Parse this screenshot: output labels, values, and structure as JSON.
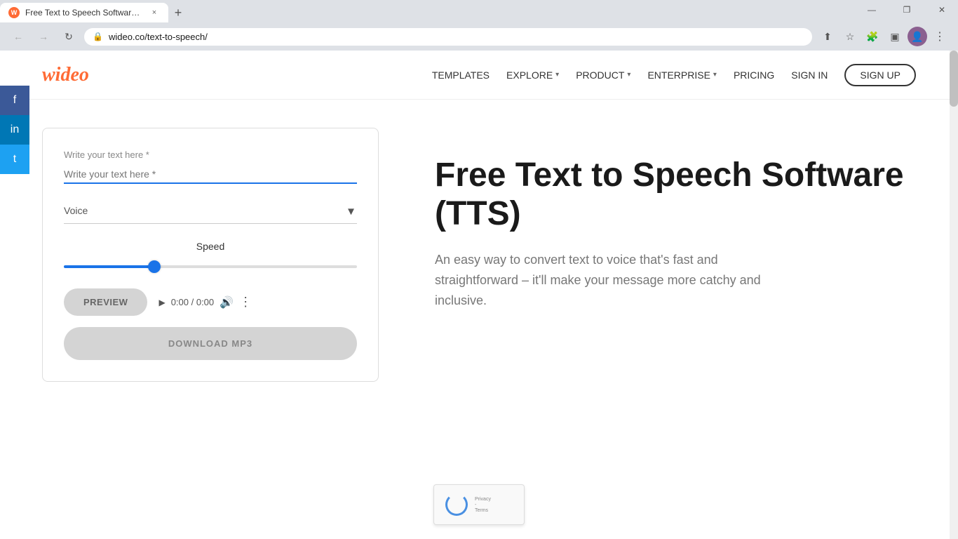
{
  "browser": {
    "tab_favicon": "W",
    "tab_title": "Free Text to Speech Software (TT",
    "tab_close": "×",
    "new_tab": "+",
    "nav_back": "←",
    "nav_forward": "→",
    "nav_refresh": "↻",
    "url": "wideo.co/text-to-speech/",
    "window_minimize": "—",
    "window_maximize": "❐",
    "window_close": "✕"
  },
  "page_title": "Free Text to Speech Software (TT — wideo.co",
  "social": {
    "facebook_icon": "f",
    "linkedin_icon": "in",
    "twitter_icon": "t"
  },
  "nav": {
    "logo": "wideo",
    "templates": "TEMPLATES",
    "explore": "EXPLORE",
    "product": "PRODUCT",
    "enterprise": "ENTERPRISE",
    "pricing": "PRICING",
    "signin": "SIGN IN",
    "signup": "SIGN UP"
  },
  "tts_tool": {
    "text_input_label": "Write your text here *",
    "text_input_value": "",
    "voice_label": "Voice",
    "speed_label": "Speed",
    "speed_value": 30,
    "preview_btn": "PREVIEW",
    "audio_time": "0:00 / 0:00",
    "download_btn": "DOWNLOAD MP3"
  },
  "hero": {
    "title": "Free Text to Speech Software (TTS)",
    "description": "An easy way to convert text to voice that's fast and straightforward – it'll make your message more catchy and inclusive."
  },
  "recaptcha": {
    "privacy": "Privacy",
    "separator": "-",
    "terms": "Terms"
  }
}
